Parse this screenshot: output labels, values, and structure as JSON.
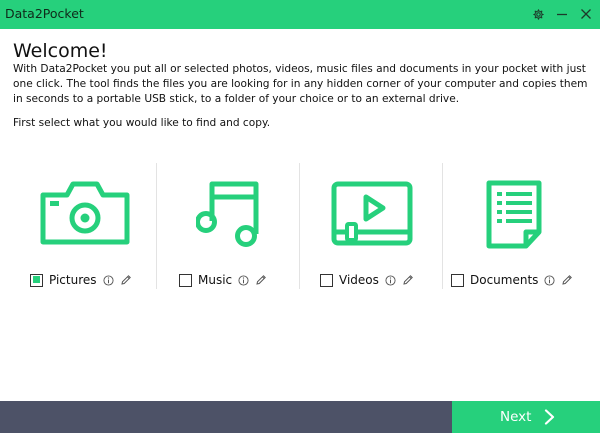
{
  "window": {
    "title": "Data2Pocket",
    "icons": [
      "gear-icon",
      "minimize-icon",
      "close-icon"
    ]
  },
  "colors": {
    "accent": "#26d07c",
    "bottom_bar": "#4d5267"
  },
  "content": {
    "heading": "Welcome!",
    "intro": "With Data2Pocket you put all or selected photos, videos, music files and documents in your pocket with just one click. The tool finds the files you are looking for in any hidden corner of your computer and copies them in seconds to a portable USB stick, to a folder of your choice or to an external drive.",
    "instruction": "First select what you would like to find and copy."
  },
  "categories": [
    {
      "label": "Pictures",
      "checked": true,
      "icon": "camera-icon"
    },
    {
      "label": "Music",
      "checked": false,
      "icon": "music-note-icon"
    },
    {
      "label": "Videos",
      "checked": false,
      "icon": "video-player-icon"
    },
    {
      "label": "Documents",
      "checked": false,
      "icon": "document-icon"
    }
  ],
  "footer": {
    "next_label": "Next"
  }
}
